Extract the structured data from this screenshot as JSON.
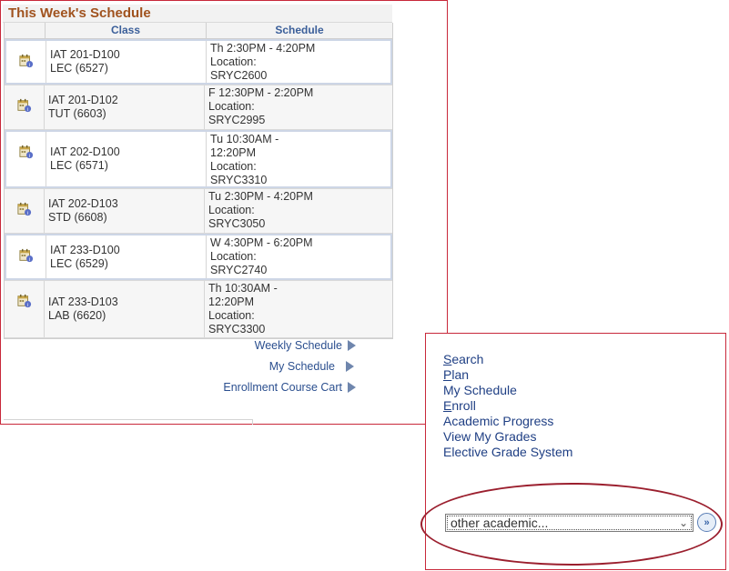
{
  "schedule": {
    "title": "This Week's Schedule",
    "headers": {
      "class": "Class",
      "schedule": "Schedule"
    },
    "rows": [
      {
        "class_line1": "IAT 201-D100",
        "class_line2": "LEC (6527)",
        "sched_lines": [
          "Th 2:30PM - 4:20PM",
          "Location:",
          "SRYC2600"
        ]
      },
      {
        "class_line1": "IAT 201-D102",
        "class_line2": "TUT (6603)",
        "sched_lines": [
          "F 12:30PM - 2:20PM",
          "Location:",
          "SRYC2995"
        ]
      },
      {
        "class_line1": "IAT 202-D100",
        "class_line2": "LEC (6571)",
        "sched_lines": [
          "Tu 10:30AM -",
          "12:20PM",
          "Location:",
          "SRYC3310"
        ]
      },
      {
        "class_line1": "IAT 202-D103",
        "class_line2": "STD (6608)",
        "sched_lines": [
          "Tu 2:30PM - 4:20PM",
          "Location:",
          "SRYC3050"
        ]
      },
      {
        "class_line1": "IAT 233-D100",
        "class_line2": "LEC (6529)",
        "sched_lines": [
          "W 4:30PM - 6:20PM",
          "Location:",
          "SRYC2740"
        ]
      },
      {
        "class_line1": "IAT 233-D103",
        "class_line2": "LAB (6620)",
        "sched_lines": [
          "Th 10:30AM -",
          "12:20PM",
          "Location:",
          "SRYC3300"
        ]
      }
    ],
    "links": [
      "Weekly Schedule",
      "My Schedule",
      "Enrollment Course Cart"
    ]
  },
  "nav": {
    "items": [
      {
        "underline": "S",
        "rest": "earch"
      },
      {
        "underline": "P",
        "rest": "lan"
      },
      {
        "underline": "",
        "rest": "My Schedule"
      },
      {
        "underline": "E",
        "rest": "nroll"
      },
      {
        "underline": "",
        "rest": "Academic Progress"
      },
      {
        "underline": "",
        "rest": "View My Grades"
      },
      {
        "underline": "",
        "rest": "Elective Grade System"
      }
    ],
    "select_value": "other academic...",
    "go_label": "»"
  },
  "icons": {
    "row_icon": "class-detail-calendar-icon",
    "link_arrow": "triangle-right-icon",
    "select_arrow": "chevron-down-icon",
    "go_icon": "double-chevron-right-icon"
  },
  "colors": {
    "title": "#a0521e",
    "link": "#2b4f8f",
    "panel_border": "#c8283a",
    "highlight_ellipse": "#9b1f2e"
  }
}
